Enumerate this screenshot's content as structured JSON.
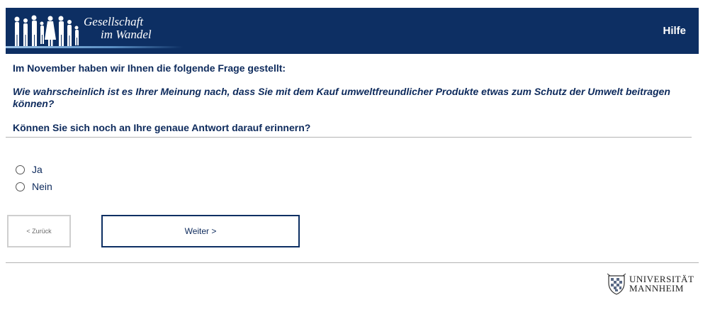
{
  "header": {
    "brand_line1": "Gesellschaft",
    "brand_line2": "im Wandel",
    "help_label": "Hilfe"
  },
  "survey": {
    "intro": "Im November haben wir Ihnen die folgende Frage gestellt:",
    "question": "Wie wahrscheinlich ist es Ihrer Meinung nach, dass Sie mit dem Kauf umweltfreundlicher Produkte etwas zum Schutz der Umwelt beitragen können?",
    "followup": "Können Sie sich noch an Ihre genaue Antwort darauf erinnern?",
    "options": [
      {
        "label": "Ja",
        "selected": false
      },
      {
        "label": "Nein",
        "selected": false
      }
    ]
  },
  "nav": {
    "back_label": "< Zurück",
    "next_label": "Weiter >"
  },
  "footer": {
    "university_line1": "UNIVERSITÄT",
    "university_line2": "MANNHEIM"
  },
  "colors": {
    "brand_navy": "#0d2f63",
    "text_navy": "#0d2a5c",
    "divider": "#b4b4b4"
  }
}
